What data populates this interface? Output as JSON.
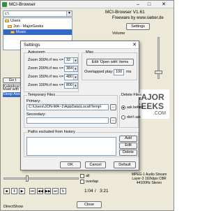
{
  "window": {
    "title": "MCI-Browser",
    "minimize": "–",
    "maximize": "□",
    "close": "✕"
  },
  "tree": {
    "drive": "c:\\",
    "items": [
      "Users",
      "Jon - MajorGeeks",
      "Music"
    ]
  },
  "info": {
    "version": "MCI-Browser V1.61",
    "freeware": "Freeware by www.sieber.de",
    "settings_label": "Settings",
    "volume_label": "Volume"
  },
  "side": {
    "go_label": "Go t"
  },
  "playlist": {
    "items": [
      "Kaleidoscope",
      "Maid with the Flaxen Hair",
      "Sleep Away"
    ],
    "selected": 2
  },
  "logo": {
    "line1": "MAJOR",
    "line2": "GEEKS",
    "line3": ".COM"
  },
  "dialog": {
    "title": "Settings",
    "close": "✕",
    "autozoom": {
      "label": "Autozoom",
      "rows": [
        {
          "text": "Zoom 300% if res <=",
          "value": "32"
        },
        {
          "text": "Zoom 200% if res <=",
          "value": "384"
        },
        {
          "text": "Zoom 150% if res <=",
          "value": "480"
        },
        {
          "text": "Zoom 100% if res <=",
          "value": "800"
        }
      ]
    },
    "misc": {
      "label": "Misc",
      "edit_button": "Edit 'Open with' items",
      "overlapped_label": "Overlapped play:",
      "overlapped_value": "100",
      "overlapped_unit": "ms"
    },
    "temp": {
      "label": "Temporary Files",
      "primary_label": "Primary:",
      "primary_value": "C:\\Users\\JON-MA~1\\AppData\\Local\\Temp\\",
      "secondary_label": "Secondary:",
      "secondary_value": "",
      "browse": "..."
    },
    "delete": {
      "label": "Delete Files",
      "ask": "ask before",
      "dont": "don't ask"
    },
    "paths": {
      "label": "Paths excluded from history",
      "add": "Add",
      "edit": "Edit",
      "delete": "Delete"
    },
    "ok": "OK",
    "cancel": "Cancel",
    "default": "Default"
  },
  "player": {
    "all_label": "all",
    "overlap_label": "overlap",
    "position": "1:04",
    "separator": "/",
    "duration": "3:21",
    "status": [
      "MPEG-1 Audio Stream",
      "Layer-3  192kbps CBR",
      "44100Hz  Stereo"
    ],
    "close_label": "Close",
    "engine": "DirectShow"
  }
}
